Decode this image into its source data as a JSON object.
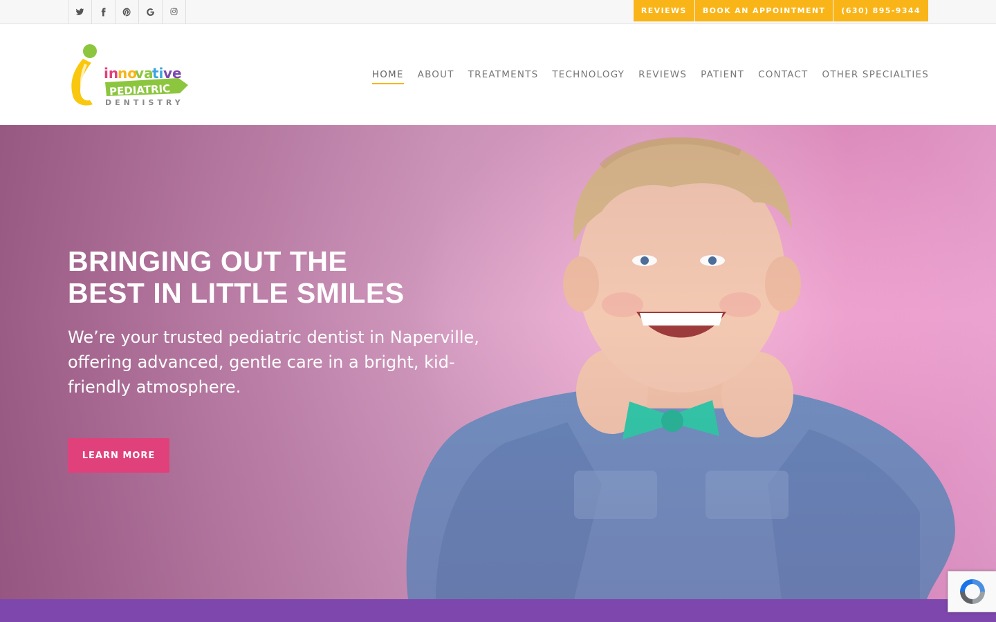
{
  "topbar": {
    "social": [
      {
        "icon": "twitter-icon",
        "glyph": "𝕥"
      },
      {
        "icon": "facebook-icon",
        "glyph": "f"
      },
      {
        "icon": "pinterest-icon",
        "glyph": "p"
      },
      {
        "icon": "google-icon",
        "glyph": "G"
      },
      {
        "icon": "instagram-icon",
        "glyph": "◎"
      }
    ],
    "buttons": {
      "reviews": "REVIEWS",
      "book": "BOOK AN APPOINTMENT",
      "phone": "(630) 895-9344"
    },
    "accent": "#f9b418"
  },
  "header": {
    "logo": {
      "line1": "innovative",
      "line2": "PEDIATRIC",
      "line3": "DENTISTRY"
    },
    "nav": {
      "home": "HOME",
      "about": "ABOUT",
      "treatments": "TREATMENTS",
      "technology": "TECHNOLOGY",
      "reviews": "REVIEWS",
      "patient": "PATIENT",
      "contact": "CONTACT",
      "other": "OTHER SPECIALTIES"
    },
    "active_nav": "HOME"
  },
  "hero": {
    "title_line1": "BRINGING OUT THE",
    "title_line2": "BEST IN LITTLE SMILES",
    "subtitle": "We’re your trusted pediatric dentist in Naperville, offering advanced, gentle care in a bright, kid-friendly atmosphere.",
    "cta": "LEARN MORE",
    "cta_color": "#e0417b"
  },
  "colors": {
    "band": "#7d47ad"
  }
}
